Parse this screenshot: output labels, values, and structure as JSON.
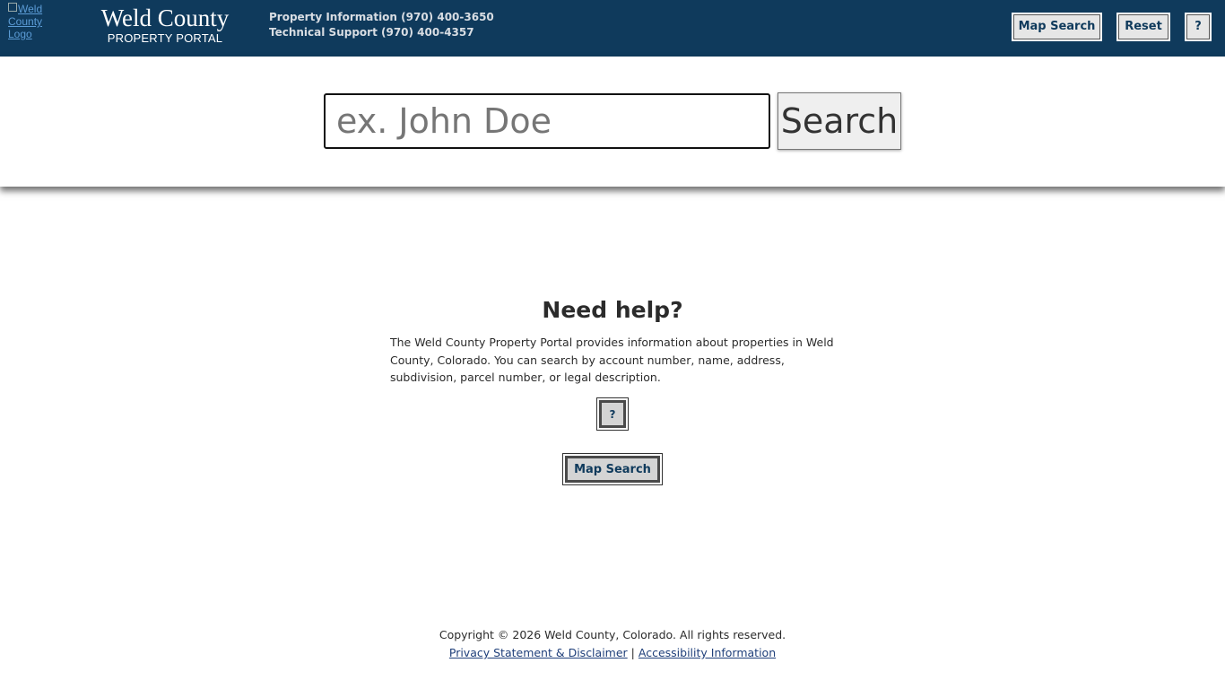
{
  "header": {
    "logo_alt": "Weld County Logo",
    "brand_title": "Weld County",
    "brand_subtitle": "PROPERTY PORTAL",
    "contact_line1": "Property Information (970) 400-3650",
    "contact_line2": "Technical Support (970) 400-4357",
    "map_search_label": "Map Search",
    "reset_label": "Reset",
    "help_label": "?"
  },
  "search": {
    "placeholder": "ex. John Doe",
    "value": "",
    "button_label": "Search"
  },
  "help": {
    "title": "Need help?",
    "description": "The Weld County Property Portal provides information about properties in Weld County, Colorado. You can search by account number, name, address, subdivision, parcel number, or legal description.",
    "help_button_label": "?",
    "map_search_label": "Map Search"
  },
  "footer": {
    "copyright": "Copyright © 2026 Weld County, Colorado. All rights reserved.",
    "privacy_link": "Privacy Statement & Disclaimer",
    "separator": "|",
    "accessibility_link": "Accessibility Information"
  },
  "colors": {
    "header_bg": "#0f3a5c",
    "button_text": "#0f3a5c",
    "link": "#1f3f7a"
  }
}
